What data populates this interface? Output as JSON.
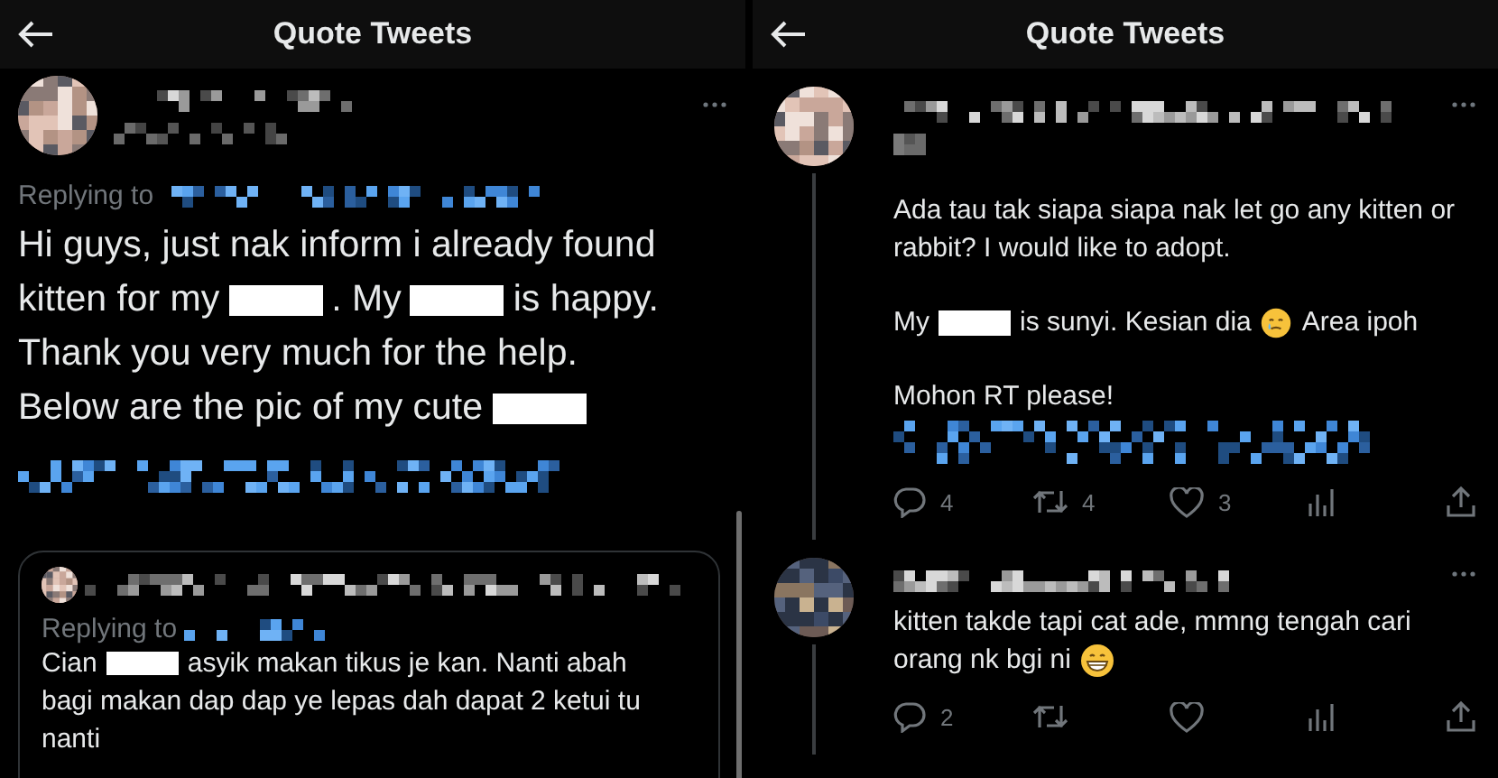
{
  "left_screen": {
    "title": "Quote Tweets",
    "main_tweet": {
      "replying_label": "Replying to",
      "lines": [
        [
          {
            "kind": "text",
            "text": "Hi guys, just nak inform i already found"
          }
        ],
        [
          {
            "kind": "text",
            "text": "kitten for my"
          },
          {
            "kind": "redacted"
          },
          {
            "kind": "text",
            "text": ". My"
          },
          {
            "kind": "redacted"
          },
          {
            "kind": "text",
            "text": "is happy."
          }
        ],
        [
          {
            "kind": "text",
            "text": "Thank you very much for the help."
          }
        ],
        [
          {
            "kind": "text",
            "text": "Below are the pic of my cute"
          },
          {
            "kind": "redacted"
          }
        ]
      ]
    },
    "quoted_tweet": {
      "replying_label": "Replying to",
      "lines": [
        [
          {
            "kind": "text",
            "text": "Cian"
          },
          {
            "kind": "redacted"
          },
          {
            "kind": "text",
            "text": "asyik makan tikus je kan. Nanti abah"
          }
        ],
        [
          {
            "kind": "text",
            "text": "bagi makan dap dap ye lepas dah dapat 2 ketui tu"
          }
        ],
        [
          {
            "kind": "text",
            "text": "nanti"
          }
        ]
      ]
    }
  },
  "right_screen": {
    "title": "Quote Tweets",
    "tweets": [
      {
        "paragraphs": [
          [
            [
              {
                "kind": "text",
                "text": "Ada tau tak siapa siapa nak let go any kitten or"
              }
            ],
            [
              {
                "kind": "text",
                "text": "rabbit? I would like to adopt."
              }
            ]
          ],
          [
            [
              {
                "kind": "text",
                "text": "My"
              },
              {
                "kind": "redacted"
              },
              {
                "kind": "text",
                "text": "is sunyi. Kesian dia"
              },
              {
                "kind": "tear-emoji"
              },
              {
                "kind": "text",
                "text": "Area ipoh"
              }
            ]
          ],
          [
            [
              {
                "kind": "text",
                "text": "Mohon RT please!"
              }
            ]
          ]
        ],
        "has_link": true,
        "actions": [
          {
            "kind": "reply",
            "count": "4"
          },
          {
            "kind": "retweet",
            "count": "4"
          },
          {
            "kind": "like",
            "count": "3"
          },
          {
            "kind": "views"
          },
          {
            "kind": "share"
          }
        ]
      },
      {
        "paragraphs": [
          [
            [
              {
                "kind": "text",
                "text": "kitten takde tapi cat ade, mmng tengah cari"
              }
            ],
            [
              {
                "kind": "text",
                "text": "orang nk bgi ni"
              },
              {
                "kind": "grin-emoji"
              }
            ]
          ]
        ],
        "has_link": false,
        "actions": [
          {
            "kind": "reply",
            "count": "2"
          },
          {
            "kind": "retweet"
          },
          {
            "kind": "like"
          },
          {
            "kind": "views"
          },
          {
            "kind": "share"
          }
        ]
      }
    ]
  }
}
